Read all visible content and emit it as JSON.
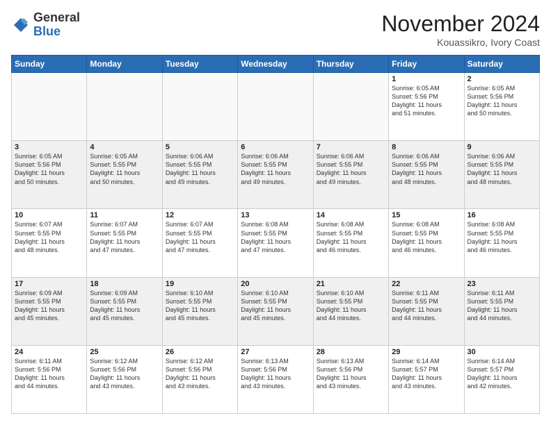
{
  "header": {
    "logo_line1": "General",
    "logo_line2": "Blue",
    "month": "November 2024",
    "location": "Kouassikro, Ivory Coast"
  },
  "weekdays": [
    "Sunday",
    "Monday",
    "Tuesday",
    "Wednesday",
    "Thursday",
    "Friday",
    "Saturday"
  ],
  "weeks": [
    [
      {
        "day": "",
        "info": ""
      },
      {
        "day": "",
        "info": ""
      },
      {
        "day": "",
        "info": ""
      },
      {
        "day": "",
        "info": ""
      },
      {
        "day": "",
        "info": ""
      },
      {
        "day": "1",
        "info": "Sunrise: 6:05 AM\nSunset: 5:56 PM\nDaylight: 11 hours\nand 51 minutes."
      },
      {
        "day": "2",
        "info": "Sunrise: 6:05 AM\nSunset: 5:56 PM\nDaylight: 11 hours\nand 50 minutes."
      }
    ],
    [
      {
        "day": "3",
        "info": "Sunrise: 6:05 AM\nSunset: 5:56 PM\nDaylight: 11 hours\nand 50 minutes."
      },
      {
        "day": "4",
        "info": "Sunrise: 6:05 AM\nSunset: 5:55 PM\nDaylight: 11 hours\nand 50 minutes."
      },
      {
        "day": "5",
        "info": "Sunrise: 6:06 AM\nSunset: 5:55 PM\nDaylight: 11 hours\nand 49 minutes."
      },
      {
        "day": "6",
        "info": "Sunrise: 6:06 AM\nSunset: 5:55 PM\nDaylight: 11 hours\nand 49 minutes."
      },
      {
        "day": "7",
        "info": "Sunrise: 6:06 AM\nSunset: 5:55 PM\nDaylight: 11 hours\nand 49 minutes."
      },
      {
        "day": "8",
        "info": "Sunrise: 6:06 AM\nSunset: 5:55 PM\nDaylight: 11 hours\nand 48 minutes."
      },
      {
        "day": "9",
        "info": "Sunrise: 6:06 AM\nSunset: 5:55 PM\nDaylight: 11 hours\nand 48 minutes."
      }
    ],
    [
      {
        "day": "10",
        "info": "Sunrise: 6:07 AM\nSunset: 5:55 PM\nDaylight: 11 hours\nand 48 minutes."
      },
      {
        "day": "11",
        "info": "Sunrise: 6:07 AM\nSunset: 5:55 PM\nDaylight: 11 hours\nand 47 minutes."
      },
      {
        "day": "12",
        "info": "Sunrise: 6:07 AM\nSunset: 5:55 PM\nDaylight: 11 hours\nand 47 minutes."
      },
      {
        "day": "13",
        "info": "Sunrise: 6:08 AM\nSunset: 5:55 PM\nDaylight: 11 hours\nand 47 minutes."
      },
      {
        "day": "14",
        "info": "Sunrise: 6:08 AM\nSunset: 5:55 PM\nDaylight: 11 hours\nand 46 minutes."
      },
      {
        "day": "15",
        "info": "Sunrise: 6:08 AM\nSunset: 5:55 PM\nDaylight: 11 hours\nand 46 minutes."
      },
      {
        "day": "16",
        "info": "Sunrise: 6:08 AM\nSunset: 5:55 PM\nDaylight: 11 hours\nand 46 minutes."
      }
    ],
    [
      {
        "day": "17",
        "info": "Sunrise: 6:09 AM\nSunset: 5:55 PM\nDaylight: 11 hours\nand 45 minutes."
      },
      {
        "day": "18",
        "info": "Sunrise: 6:09 AM\nSunset: 5:55 PM\nDaylight: 11 hours\nand 45 minutes."
      },
      {
        "day": "19",
        "info": "Sunrise: 6:10 AM\nSunset: 5:55 PM\nDaylight: 11 hours\nand 45 minutes."
      },
      {
        "day": "20",
        "info": "Sunrise: 6:10 AM\nSunset: 5:55 PM\nDaylight: 11 hours\nand 45 minutes."
      },
      {
        "day": "21",
        "info": "Sunrise: 6:10 AM\nSunset: 5:55 PM\nDaylight: 11 hours\nand 44 minutes."
      },
      {
        "day": "22",
        "info": "Sunrise: 6:11 AM\nSunset: 5:55 PM\nDaylight: 11 hours\nand 44 minutes."
      },
      {
        "day": "23",
        "info": "Sunrise: 6:11 AM\nSunset: 5:55 PM\nDaylight: 11 hours\nand 44 minutes."
      }
    ],
    [
      {
        "day": "24",
        "info": "Sunrise: 6:11 AM\nSunset: 5:56 PM\nDaylight: 11 hours\nand 44 minutes."
      },
      {
        "day": "25",
        "info": "Sunrise: 6:12 AM\nSunset: 5:56 PM\nDaylight: 11 hours\nand 43 minutes."
      },
      {
        "day": "26",
        "info": "Sunrise: 6:12 AM\nSunset: 5:56 PM\nDaylight: 11 hours\nand 43 minutes."
      },
      {
        "day": "27",
        "info": "Sunrise: 6:13 AM\nSunset: 5:56 PM\nDaylight: 11 hours\nand 43 minutes."
      },
      {
        "day": "28",
        "info": "Sunrise: 6:13 AM\nSunset: 5:56 PM\nDaylight: 11 hours\nand 43 minutes."
      },
      {
        "day": "29",
        "info": "Sunrise: 6:14 AM\nSunset: 5:57 PM\nDaylight: 11 hours\nand 43 minutes."
      },
      {
        "day": "30",
        "info": "Sunrise: 6:14 AM\nSunset: 5:57 PM\nDaylight: 11 hours\nand 42 minutes."
      }
    ]
  ]
}
